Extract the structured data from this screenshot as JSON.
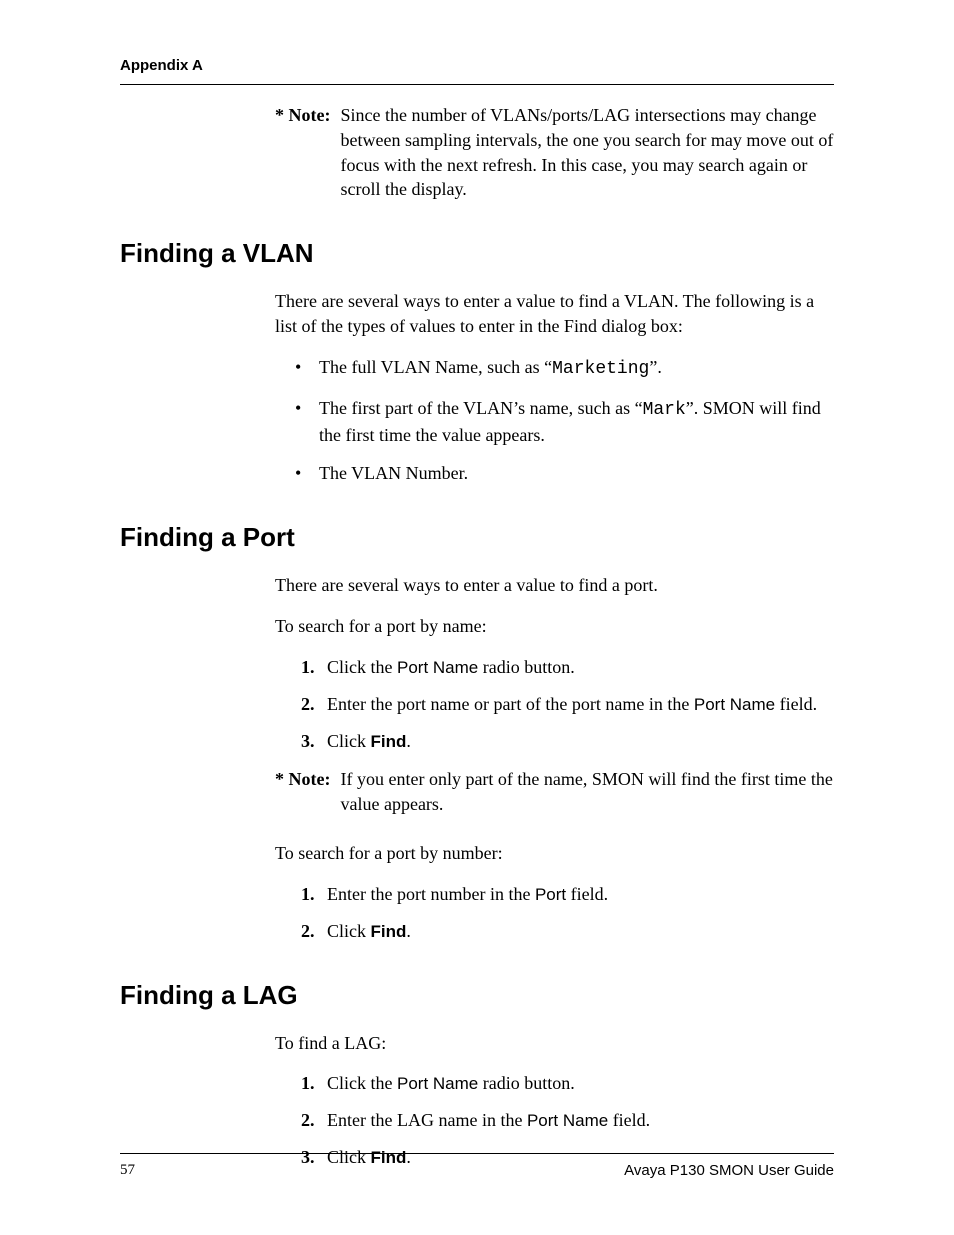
{
  "header": {
    "appendix": "Appendix A"
  },
  "top_note": {
    "label": "* Note:",
    "text": "Since the number of VLANs/ports/LAG intersections may change between sampling intervals, the one you search for may move out of focus with the next refresh. In this case, you may search again or scroll the display."
  },
  "vlan": {
    "heading": "Finding a VLAN",
    "intro": "There are several ways to enter a value to find a VLAN. The following is a list of the types of values to enter in the Find dialog box:",
    "b1_a": "The full VLAN Name, such as “",
    "b1_code": "Marketing",
    "b1_b": "”.",
    "b2_a": "The first part of the VLAN’s name, such as “",
    "b2_code": "Mark",
    "b2_b": "”. SMON will find the first time the value appears.",
    "b3": "The VLAN Number."
  },
  "port": {
    "heading": "Finding a Port",
    "intro": "There are several ways to enter a value to find a port.",
    "byname_lead": "To search for a port by name:",
    "s1_a": "Click the ",
    "s1_ui": "Port Name",
    "s1_b": " radio button.",
    "s2_a": "Enter the port name or part of the port name in the ",
    "s2_ui": "Port Name",
    "s2_b": " field.",
    "s3_a": "Click ",
    "s3_ui": "Find",
    "s3_b": ".",
    "note_label": "* Note:",
    "note_text": "If you enter only part of the name, SMON will find the first time the value appears.",
    "bynum_lead": "To search for a port by number:",
    "n1_a": "Enter the port number in the ",
    "n1_ui": "Port",
    "n1_b": " field.",
    "n2_a": "Click ",
    "n2_ui": "Find",
    "n2_b": "."
  },
  "lag": {
    "heading": "Finding a LAG",
    "intro": "To find a LAG:",
    "s1_a": "Click the ",
    "s1_ui": "Port Name",
    "s1_b": " radio button.",
    "s2_a": "Enter the LAG name in the ",
    "s2_ui": "Port Name",
    "s2_b": " field.",
    "s3_a": "Click ",
    "s3_ui": "Find",
    "s3_b": "."
  },
  "footer": {
    "page": "57",
    "title": "Avaya P130 SMON User Guide"
  }
}
